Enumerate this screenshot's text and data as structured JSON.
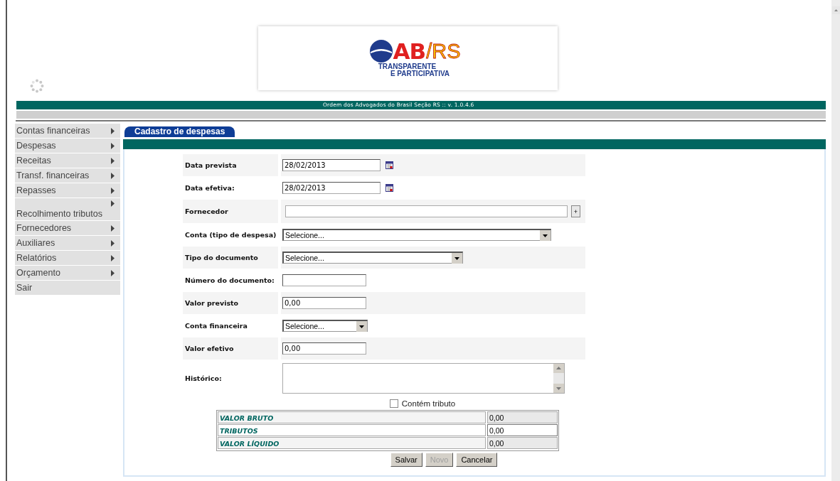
{
  "logo": {
    "letters": "AB",
    "suffix": "/RS",
    "line_1": "TRANSPARENTE",
    "line_2": "E PARTICIPATIVA"
  },
  "banner": "Ordem dos Advogados do Brasil Seção RS :: v. 1.0.4.6",
  "menu": [
    {
      "label": "Contas financeiras",
      "has_submenu": true
    },
    {
      "label": "Despesas",
      "has_submenu": true
    },
    {
      "label": "Receitas",
      "has_submenu": true
    },
    {
      "label": "Transf. financeiras",
      "has_submenu": true
    },
    {
      "label": "Repasses",
      "has_submenu": true
    },
    {
      "label": "Recolhimento tributos",
      "has_submenu": true
    },
    {
      "label": "Fornecedores",
      "has_submenu": true
    },
    {
      "label": "Auxiliares",
      "has_submenu": true
    },
    {
      "label": "Relatórios",
      "has_submenu": true
    },
    {
      "label": "Orçamento",
      "has_submenu": true
    },
    {
      "label": "Sair",
      "has_submenu": false
    }
  ],
  "tab": {
    "label": "Cadastro de despesas",
    "selected": true
  },
  "form": [
    {
      "label": "Data prevista",
      "kind": "date",
      "value": "28/02/2013"
    },
    {
      "label": "Data efetiva:",
      "kind": "date",
      "value": "28/02/2013"
    },
    {
      "label": "Fornecedor",
      "kind": "lookup",
      "button": "+"
    },
    {
      "label": "Conta (tipo de despesa)",
      "kind": "select",
      "value": "Selecione..."
    },
    {
      "label": "Tipo do documento",
      "kind": "select",
      "value": "Selecione..."
    },
    {
      "label": "Número do documento:",
      "kind": "text"
    },
    {
      "label": "Valor previsto",
      "kind": "text",
      "value": "0,00"
    },
    {
      "label": "Conta financeira",
      "kind": "select",
      "value": "Selecione..."
    },
    {
      "label": "Valor efetivo",
      "kind": "text",
      "value": "0,00"
    },
    {
      "label": "Histórico:",
      "kind": "textarea"
    }
  ],
  "tax_checkbox": {
    "label": "Contém tributo",
    "checked": false
  },
  "totals": [
    {
      "label": "VALOR BRUTO",
      "value": "0,00",
      "editable": false
    },
    {
      "label": "TRIBUTOS",
      "value": "0,00",
      "editable": true
    },
    {
      "label": "VALOR LÍQUIDO",
      "value": "0,00",
      "editable": false
    }
  ],
  "buttons": [
    {
      "label": "Salvar",
      "disabled": false
    },
    {
      "label": "Novo",
      "disabled": true
    },
    {
      "label": "Cancelar",
      "disabled": false
    }
  ]
}
